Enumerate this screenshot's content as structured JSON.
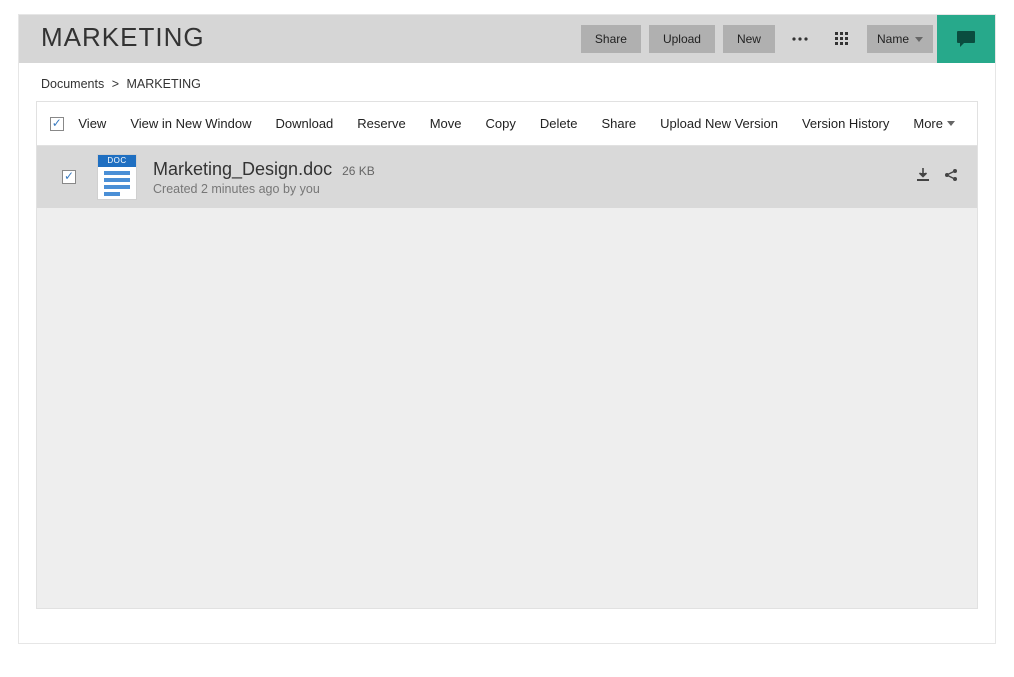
{
  "header": {
    "title": "MARKETING",
    "share_label": "Share",
    "upload_label": "Upload",
    "new_label": "New",
    "sort_label": "Name"
  },
  "breadcrumb": {
    "root": "Documents",
    "current": "MARKETING"
  },
  "actions": {
    "view": "View",
    "view_new_window": "View in New Window",
    "download": "Download",
    "reserve": "Reserve",
    "move": "Move",
    "copy": "Copy",
    "delete": "Delete",
    "share": "Share",
    "upload_new_version": "Upload New Version",
    "version_history": "Version History",
    "more": "More"
  },
  "file": {
    "icon_label": "DOC",
    "name": "Marketing_Design.doc",
    "size": "26 KB",
    "subtitle": "Created 2 minutes ago by you"
  }
}
